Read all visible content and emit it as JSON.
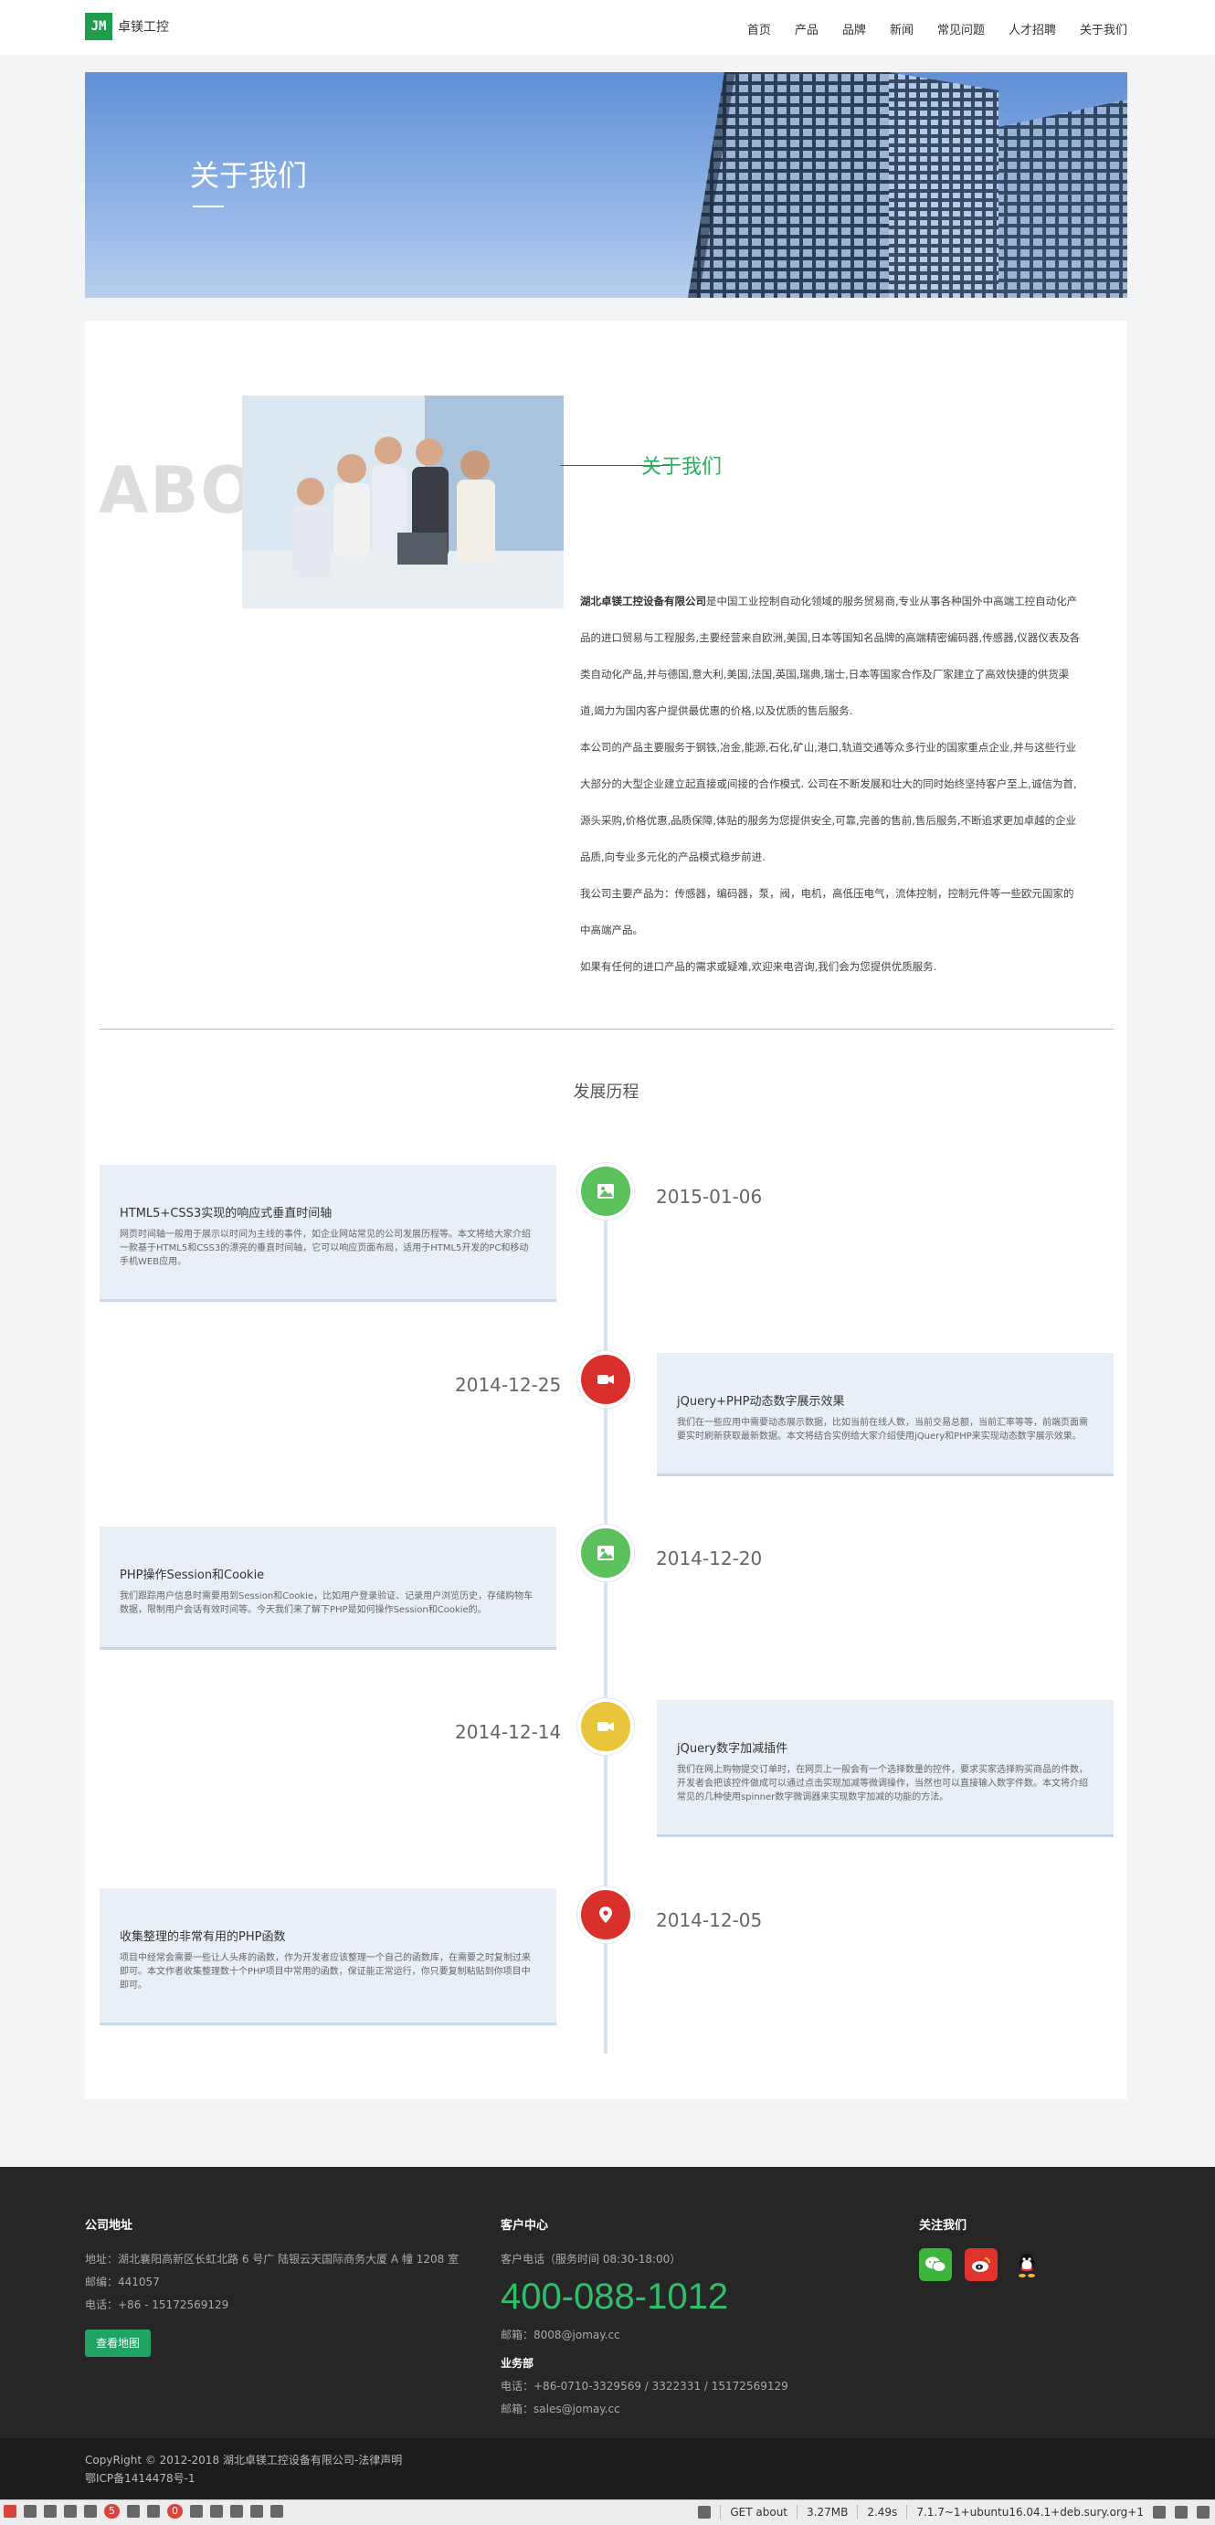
{
  "header": {
    "logo_mark": "JM",
    "logo_text": "卓镁工控",
    "nav": [
      "首页",
      "产品",
      "品牌",
      "新闻",
      "常见问题",
      "人才招聘",
      "关于我们"
    ]
  },
  "banner": {
    "title": "关于我们"
  },
  "about": {
    "bg_text": "ABOUT",
    "heading": "关于我们",
    "company": "湖北卓镁工控设备有限公司",
    "p1": "是中国工业控制自动化领域的服务贸易商,专业从事各种国外中高端工控自动化产品的进口贸易与工程服务,主要经营来自欧洲,美国,日本等国知名品牌的高端精密编码器,传感器,仪器仪表及各类自动化产品,并与德国,意大利,美国,法国,英国,瑞典,瑞士,日本等国家合作及厂家建立了高效快捷的供货渠道,竭力为国内客户提供最优惠的价格,以及优质的售后服务.",
    "p2": "本公司的产品主要服务于钢铁,冶金,能源,石化,矿山,港口,轨道交通等众多行业的国家重点企业,并与这些行业大部分的大型企业建立起直接或间接的合作模式. 公司在不断发展和壮大的同时始终坚持客户至上,诚信为首,源头采购,价格优惠,品质保障,体贴的服务为您提供安全,可靠,完善的售前,售后服务,不断追求更加卓越的企业品质,向专业多元化的产品模式稳步前进.",
    "p3": "我公司主要产品为：传感器，编码器，泵，阀，电机，高低压电气，流体控制，控制元件等一些欧元国家的中高端产品。",
    "p4": "如果有任何的进口产品的需求或疑难,欢迎来电咨询,我们会为您提供优质服务."
  },
  "timeline": {
    "title": "发展历程",
    "items": [
      {
        "date": "2015-01-06",
        "title": "HTML5+CSS3实现的响应式垂直时间轴",
        "desc": "网页时间轴一般用于展示以时间为主线的事件，如企业网站常见的公司发展历程等。本文将给大家介绍一款基于HTML5和CSS3的漂亮的垂直时间轴，它可以响应页面布局，适用于HTML5开发的PC和移动手机WEB应用。",
        "icon": "picture-icon",
        "color": "#5cc15c"
      },
      {
        "date": "2014-12-25",
        "title": "jQuery+PHP动态数字展示效果",
        "desc": "我们在一些应用中需要动态展示数据，比如当前在线人数，当前交易总额，当前汇率等等，前端页面需要实时刷新获取最新数据。本文将结合实例给大家介绍使用jQuery和PHP来实现动态数字展示效果。",
        "icon": "video-icon",
        "color": "#d9302c"
      },
      {
        "date": "2014-12-20",
        "title": "PHP操作Session和Cookie",
        "desc": "我们跟踪用户信息时需要用到Session和Cookie，比如用户登录验证、记录用户浏览历史，存储购物车数据，限制用户会话有效时间等。今天我们来了解下PHP是如何操作Session和Cookie的。",
        "icon": "picture-icon",
        "color": "#5cc15c"
      },
      {
        "date": "2014-12-14",
        "title": "jQuery数字加减插件",
        "desc": "我们在网上购物提交订单时，在网页上一般会有一个选择数量的控件，要求买家选择购买商品的件数，开发者会把该控件做成可以通过点击实现加减等微调操作，当然也可以直接输入数字件数。本文将介绍常见的几种使用spinner数字微调器来实现数字加减的功能的方法。",
        "icon": "video-icon",
        "color": "#e8c53a"
      },
      {
        "date": "2014-12-05",
        "title": "收集整理的非常有用的PHP函数",
        "desc": "项目中经常会需要一些让人头疼的函数，作为开发者应该整理一个自己的函数库，在需要之时复制过来即可。本文作者收集整理数十个PHP项目中常用的函数，保证能正常运行，你只要复制粘贴到你项目中即可。",
        "icon": "location-icon",
        "color": "#d9302c"
      }
    ]
  },
  "footer": {
    "col1": {
      "title": "公司地址",
      "address": "地址：湖北襄阳高新区长虹北路 6 号广 陆银云天国际商务大厦 A 幢 1208 室",
      "postcode": "邮编：441057",
      "phone": "电话：+86 - 15172569129",
      "map_button": "查看地图"
    },
    "col2": {
      "title": "客户中心",
      "service_time": "客户电话（服务时间 08:30-18:00）",
      "hotline": "400-088-1012",
      "email": "邮箱：8008@jomay.cc",
      "biz_title": "业务部",
      "biz_phone": "电话：+86-0710-3329569 / 3322331 / 15172569129",
      "biz_email": "邮箱：sales@jomay.cc"
    },
    "col3": {
      "title": "关注我们"
    },
    "copyright": "CopyRight © 2012-2018 湖北卓镁工控设备有限公司-法律声明",
    "icp": "鄂ICP备1414478号-1"
  },
  "debugbar": {
    "badge1": "5",
    "badge2": "0",
    "request": "GET about",
    "memory": "3.27MB",
    "time": "2.49s",
    "php": "7.1.7~1+ubuntu16.04.1+deb.sury.org+1"
  }
}
